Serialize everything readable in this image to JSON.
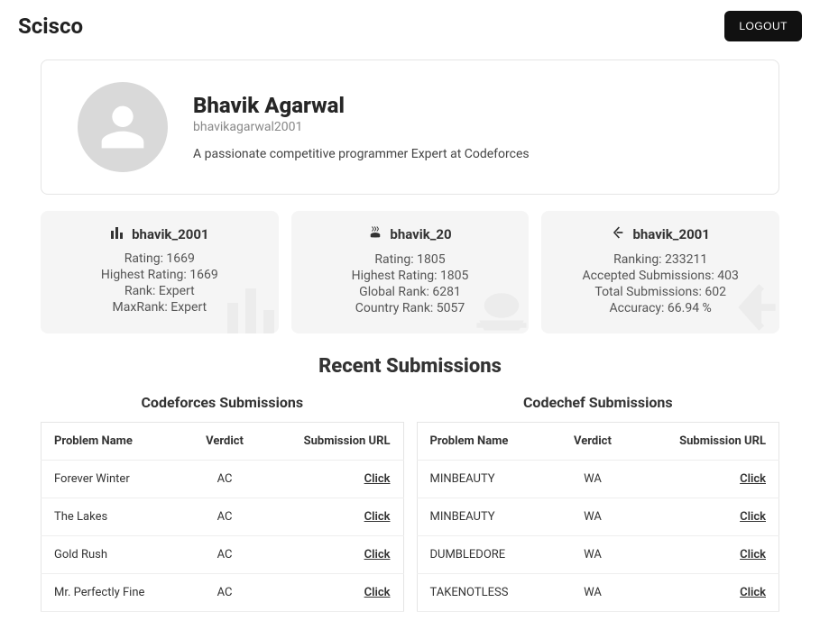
{
  "header": {
    "brand": "Scisco",
    "logout_label": "LOGOUT"
  },
  "profile": {
    "name": "Bhavik Agarwal",
    "handle": "bhavikagarwal2001",
    "bio": "A passionate competitive programmer Expert at Codeforces"
  },
  "stats": {
    "codeforces": {
      "handle": "bhavik_2001",
      "rating_label": "Rating: 1669",
      "highest_label": "Highest Rating: 1669",
      "rank_label": "Rank: Expert",
      "maxrank_label": "MaxRank: Expert"
    },
    "codechef": {
      "handle": "bhavik_20",
      "rating_label": "Rating: 1805",
      "highest_label": "Highest Rating: 1805",
      "global_label": "Global Rank: 6281",
      "country_label": "Country Rank: 5057"
    },
    "leetcode": {
      "handle": "bhavik_2001",
      "ranking_label": "Ranking: 233211",
      "accepted_label": "Accepted Submissions: 403",
      "total_label": "Total Submissions: 602",
      "accuracy_label": "Accuracy: 66.94 %"
    }
  },
  "recent_title": "Recent Submissions",
  "tables": {
    "cf_title": "Codeforces Submissions",
    "cc_title": "Codechef Submissions",
    "col_problem": "Problem Name",
    "col_verdict": "Verdict",
    "col_url": "Submission URL",
    "click_label": "Click",
    "cf_rows": [
      {
        "problem": "Forever Winter",
        "verdict": "AC"
      },
      {
        "problem": "The Lakes",
        "verdict": "AC"
      },
      {
        "problem": "Gold Rush",
        "verdict": "AC"
      },
      {
        "problem": "Mr. Perfectly Fine",
        "verdict": "AC"
      }
    ],
    "cc_rows": [
      {
        "problem": "MINBEAUTY",
        "verdict": "WA"
      },
      {
        "problem": "MINBEAUTY",
        "verdict": "WA"
      },
      {
        "problem": "DUMBLEDORE",
        "verdict": "WA"
      },
      {
        "problem": "TAKENOTLESS",
        "verdict": "WA"
      }
    ]
  }
}
